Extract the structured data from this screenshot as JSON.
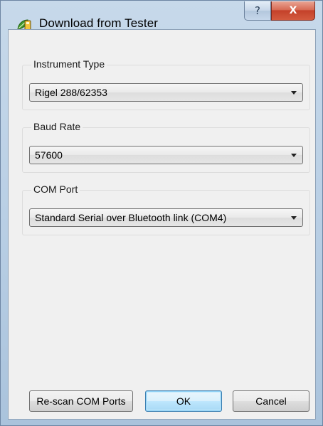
{
  "window": {
    "title": "Download from Tester",
    "help_glyph": "?",
    "close_glyph": "X"
  },
  "groups": {
    "instrument_type": {
      "label": "Instrument Type",
      "value": "Rigel 288/62353"
    },
    "baud_rate": {
      "label": "Baud Rate",
      "value": "57600"
    },
    "com_port": {
      "label": "COM Port",
      "value": "Standard Serial over Bluetooth link (COM4)"
    }
  },
  "buttons": {
    "rescan": "Re-scan COM Ports",
    "ok": "OK",
    "cancel": "Cancel"
  },
  "icons": {
    "app": "leaf-tester-icon",
    "help": "help-icon",
    "close": "close-icon",
    "dropdown": "chevron-down-icon"
  },
  "colors": {
    "title_bar": "#b9cfe5",
    "close_button": "#c4412a",
    "dialog_bg": "#f0f0f0",
    "default_button_border": "#3c7fb1"
  }
}
